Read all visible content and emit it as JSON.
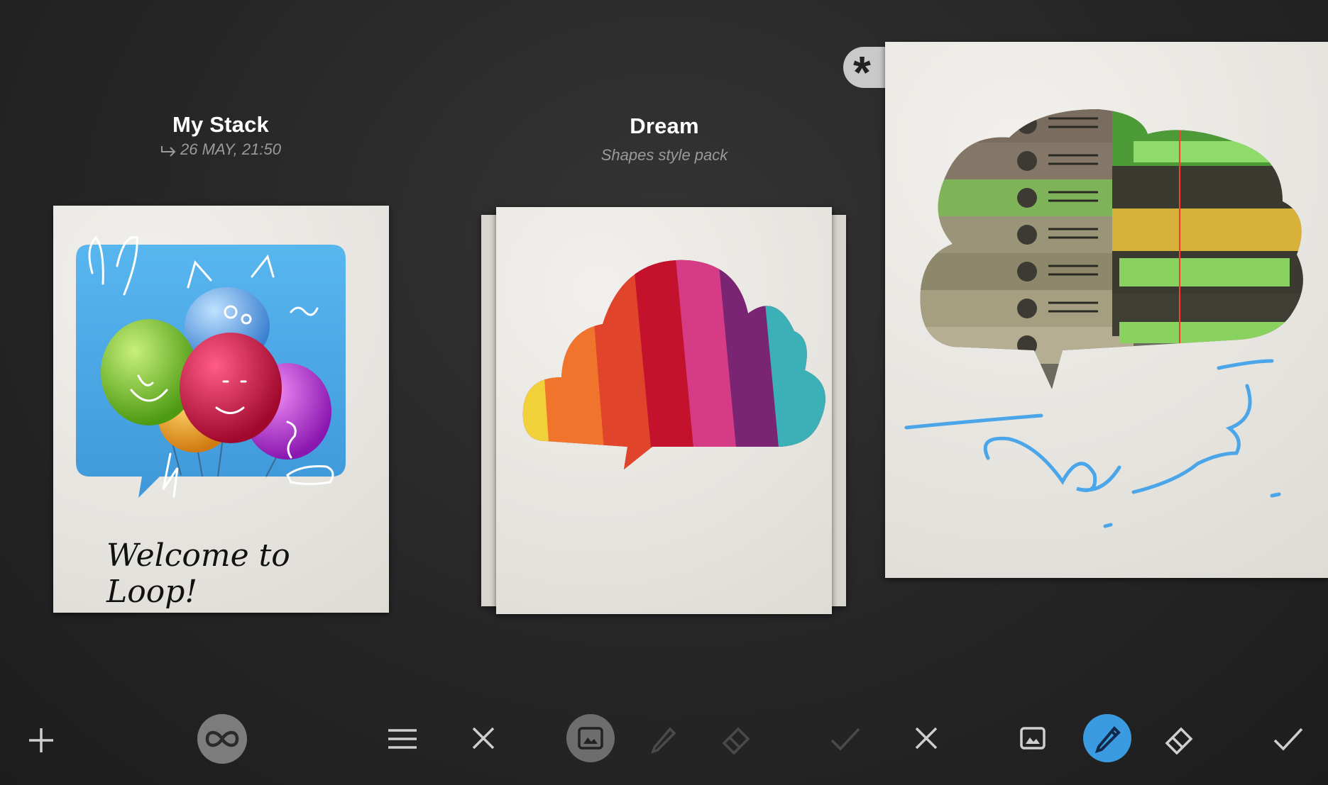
{
  "panels": [
    {
      "title": "My Stack",
      "subtitle": "26 MAY, 21:50",
      "card_text": "Welcome to Loop!"
    },
    {
      "title": "Dream",
      "subtitle": "Shapes style pack"
    }
  ],
  "editor": {
    "asterisk_label": "*"
  },
  "toolbar": {
    "left": [
      "plus-icon",
      "loop-icon",
      "menu-icon"
    ],
    "middle": [
      "close-icon",
      "image-icon",
      "pen-icon",
      "eraser-icon",
      "check-icon"
    ],
    "right": [
      "close-icon",
      "image-icon",
      "pen-icon",
      "eraser-icon",
      "check-icon"
    ]
  },
  "colors": {
    "accent": "#3a9be0",
    "sketch": "#4aa6e8",
    "toolbar_icon": "#cfcfcf",
    "disabled_icon": "#4a4a4a"
  }
}
